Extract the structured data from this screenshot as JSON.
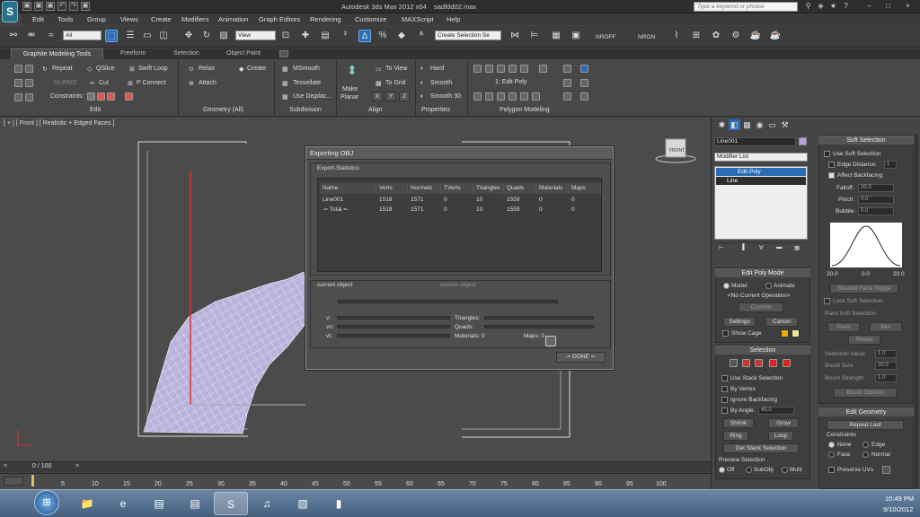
{
  "titlebar": {
    "app_logo": "S",
    "title": "Autodesk 3ds Max 2012 x64",
    "filename": "sadfdd02.max",
    "search_placeholder": "Type a keyword or phrase",
    "quick_access": [
      "▣",
      "▣",
      "▣",
      "↶",
      "↷",
      "▣"
    ]
  },
  "menu": [
    "Edit",
    "Tools",
    "Group",
    "Views",
    "Create",
    "Modifiers",
    "Animation",
    "Graph Editors",
    "Rendering",
    "Customize",
    "MAXScript",
    "Help"
  ],
  "toolbar": {
    "selection_filter": "All",
    "ref_coord": "View",
    "named_selection": "Create Selection Se",
    "nroff": "NROFF",
    "nron": "NRON"
  },
  "ribbon": {
    "tabs": [
      "Graphite Modeling Tools",
      "Freeform",
      "Selection",
      "Object Paint"
    ],
    "edit": {
      "repeat": "Repeat",
      "qslice": "QSlice",
      "swift_loop": "Swift Loop",
      "modify": "NURMS",
      "cut": "Cut",
      "p_connect": "P Connect",
      "constraints": "Constraints:"
    },
    "geometry": {
      "relax": "Relax",
      "create": "Create",
      "attach": "Attach"
    },
    "subdivision": {
      "msmooth": "MSmooth",
      "tessellate": "Tessellate",
      "use_displace": "Use Displac..."
    },
    "align": {
      "make_planar_1": "Make",
      "make_planar_2": "Planar",
      "to_view": "To View",
      "to_grid": "To Grid",
      "x": "X",
      "y": "Y",
      "z": "Z"
    },
    "properties": {
      "hard": "Hard",
      "smooth": "Smooth",
      "smooth30": "Smooth 30"
    },
    "polygon_modeling": {
      "level": "1: Edit Poly"
    },
    "footers": [
      "Edit",
      "Geometry (All)",
      "Subdivision",
      "Align",
      "Properties",
      "Polygon Modeling"
    ]
  },
  "viewport": {
    "label": "[ + ] [ Front ] [ Realistic + Edged Faces ]",
    "viewcube": "FRONT"
  },
  "dialog": {
    "title": "Exporting OBJ",
    "group_label": "Export-Statistics",
    "columns": [
      "Name",
      "Verts",
      "Normals",
      "TVerts",
      "Triangles",
      "Quads",
      "Materials",
      "Maps"
    ],
    "rows": [
      [
        "Line001",
        "1518",
        "1571",
        "0",
        "10",
        "1559",
        "0",
        "0"
      ],
      [
        "-= Total =-",
        "1518",
        "1571",
        "0",
        "10",
        "1559",
        "0",
        "0"
      ]
    ],
    "current_object": "current object",
    "current_object_2": "current object",
    "v_label": "v:",
    "vn_label": "vn:",
    "vt_label": "vt:",
    "triangles_label": "Triangles:",
    "quads_label": "Quads:",
    "materials_label": "Materials: 0",
    "maps_label": "Maps: 0",
    "done_label": "-= DONE =-"
  },
  "timeline": {
    "frame_counter": "0 / 100",
    "ticks": [
      "5",
      "10",
      "15",
      "20",
      "25",
      "30",
      "35",
      "40",
      "45",
      "50",
      "55",
      "60",
      "65",
      "70",
      "75",
      "80",
      "85",
      "90",
      "95",
      "100"
    ]
  },
  "command_panel": {
    "object_name": "Line001",
    "modifier_list": "Modifier List",
    "stack": [
      "Edit Poly",
      "Line"
    ],
    "edit_poly_mode": {
      "header": "Edit Poly Mode",
      "model": "Model",
      "animate": "Animate",
      "no_op": "<No Current Operation>",
      "commit": "Commit",
      "settings": "Settings",
      "cancel": "Cancel",
      "show_cage": "Show Cage"
    },
    "selection": {
      "header": "Selection",
      "use_stack": "Use Stack Selection",
      "by_vertex": "By Vertex",
      "ignore_backfacing": "Ignore Backfacing",
      "by_angle": "By Angle:",
      "by_angle_value": "45.0",
      "shrink": "Shrink",
      "grow": "Grow",
      "ring": "Ring",
      "loop": "Loop",
      "get_stack": "Get Stack Selection",
      "preview": "Preview Selection",
      "off": "Off",
      "subobj": "SubObj",
      "multi": "Multi"
    },
    "soft_selection": {
      "header": "Soft Selection",
      "use_soft": "Use Soft Selection",
      "edge_distance": "Edge Distance:",
      "edge_distance_value": "1",
      "affect_backfacing": "Affect Backfacing",
      "falloff": "Falloff:",
      "falloff_value": "20.0",
      "pinch": "Pinch:",
      "pinch_value": "0.0",
      "bubble": "Bubble:",
      "bubble_value": "0.0",
      "curve_labels": [
        "20.0",
        "0.0",
        "20.0"
      ],
      "shaded_face": "Shaded Face Toggle",
      "lock_soft": "Lock Soft Selection",
      "paint_soft": "Paint Soft Selection",
      "paint": "Paint",
      "blur": "Blur",
      "revert": "Revert",
      "selection_value": "Selection Value",
      "selection_value_v": "1.0",
      "brush_size": "Brush Size",
      "brush_size_v": "20.0",
      "brush_strength": "Brush Strength",
      "brush_strength_v": "1.0",
      "brush_options": "Brush Options"
    },
    "edit_geometry": {
      "header": "Edit Geometry",
      "repeat_last": "Repeat Last",
      "constraints": "Constraints",
      "none": "None",
      "edge": "Edge",
      "face": "Face",
      "normal": "Normal",
      "preserve_uvs": "Preserve UVs"
    }
  },
  "taskbar": {
    "time": "10:49 PM",
    "date": "9/10/2012",
    "start": "⊞",
    "apps": [
      "📁",
      "e",
      "▤",
      "▤",
      "S",
      "♫",
      "▨",
      "▮"
    ]
  }
}
